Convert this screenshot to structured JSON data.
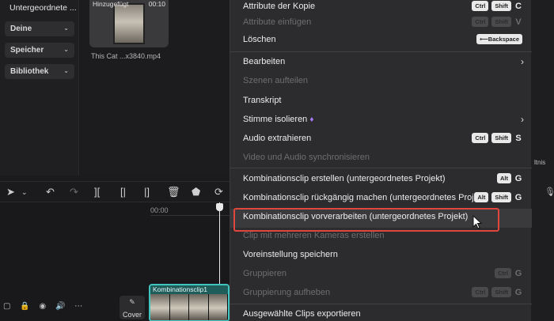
{
  "sidebar": {
    "title": "Untergeordnete ...",
    "dropdowns": [
      "Deine",
      "Speicher",
      "Bibliothek"
    ]
  },
  "media": {
    "tag": "Hinzugefügt",
    "duration": "00:10",
    "filename": "This Cat ...x3840.mp4"
  },
  "timeline": {
    "ruler_time": "00:00",
    "cover_label": "Cover",
    "clip_name": "Kombinationsclip1"
  },
  "right_edge": {
    "partial_text": "ltnis"
  },
  "menu": {
    "items": [
      {
        "label": "Attribute der Kopie",
        "disabled": false,
        "keys": [
          "Ctrl",
          "Shift"
        ],
        "key": "C"
      },
      {
        "label": "Attribute einfügen",
        "disabled": true,
        "keys": [
          "Ctrl",
          "Shift"
        ],
        "key": "V"
      },
      {
        "label": "Löschen",
        "disabled": false,
        "keys": [
          "⟵Backspace"
        ],
        "key": ""
      },
      {
        "label": "Bearbeiten",
        "disabled": false,
        "submenu": true
      },
      {
        "label": "Szenen aufteilen",
        "disabled": true
      },
      {
        "label": "Transkript",
        "disabled": false
      },
      {
        "label": "Stimme isolieren",
        "disabled": false,
        "submenu": true
      },
      {
        "label": "Audio extrahieren",
        "disabled": false,
        "keys": [
          "Ctrl",
          "Shift"
        ],
        "key": "S"
      },
      {
        "label": "Video und Audio synchronisieren",
        "disabled": true
      },
      {
        "label": "Kombinationsclip erstellen (untergeordnetes Projekt)",
        "disabled": false,
        "keys": [
          "Alt"
        ],
        "key": "G"
      },
      {
        "label": "Kombinationsclip rückgängig machen (untergeordnetes Projekt)",
        "disabled": false,
        "keys": [
          "Alt",
          "Shift"
        ],
        "key": "G"
      },
      {
        "label": "Kombinationsclip vorverarbeiten (untergeordnetes Projekt)",
        "disabled": false,
        "highlighted": true
      },
      {
        "label": "Clip mit mehreren Kameras erstellen",
        "disabled": true
      },
      {
        "label": "Voreinstellung speichern",
        "disabled": false
      },
      {
        "label": "Gruppieren",
        "disabled": true,
        "keys": [
          "Ctrl"
        ],
        "key": "G"
      },
      {
        "label": "Gruppierung aufheben",
        "disabled": true,
        "keys": [
          "Ctrl",
          "Shift"
        ],
        "key": "G"
      },
      {
        "label": "Ausgewählte Clips exportieren",
        "disabled": false
      }
    ]
  },
  "colors": {
    "highlight_border": "#e0463e",
    "clip_accent": "#3fc4c0",
    "premium_gem": "#a57bff"
  }
}
